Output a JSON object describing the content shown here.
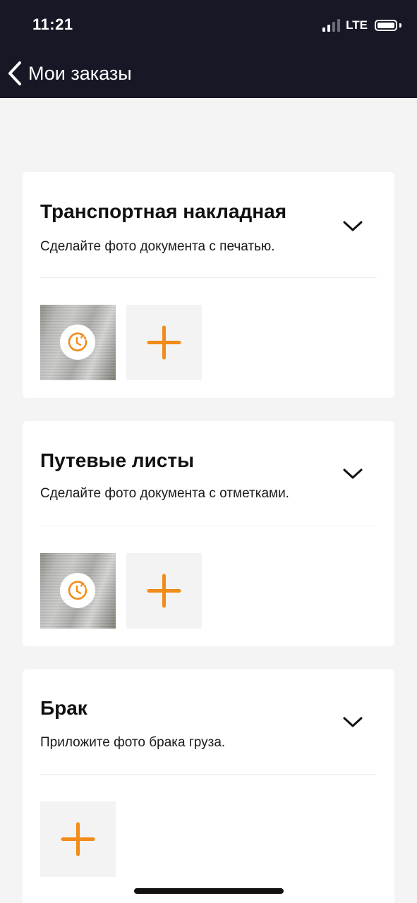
{
  "status_bar": {
    "time": "11:21",
    "network": "LTE",
    "signal_bars_active": 2,
    "signal_bars_total": 4
  },
  "nav": {
    "back_label": "Мои заказы",
    "back_icon": "chevron-left-icon"
  },
  "colors": {
    "header_bg": "#161826",
    "accent": "#f28c18",
    "page_bg": "#f4f4f4",
    "card_bg": "#ffffff",
    "tile_bg": "#f3f3f3"
  },
  "sections": [
    {
      "title": "Транспортная накладная",
      "subtitle": "Сделайте фото документа с печатью.",
      "photos": [
        {
          "status": "pending",
          "icon": "clock-pending-icon"
        }
      ],
      "add_icon": "plus-icon"
    },
    {
      "title": "Путевые листы",
      "subtitle": "Сделайте фото документа с отметками.",
      "photos": [
        {
          "status": "pending",
          "icon": "clock-pending-icon"
        }
      ],
      "add_icon": "plus-icon"
    },
    {
      "title": "Брак",
      "subtitle": "Приложите фото брака груза.",
      "photos": [],
      "add_icon": "plus-icon"
    }
  ]
}
